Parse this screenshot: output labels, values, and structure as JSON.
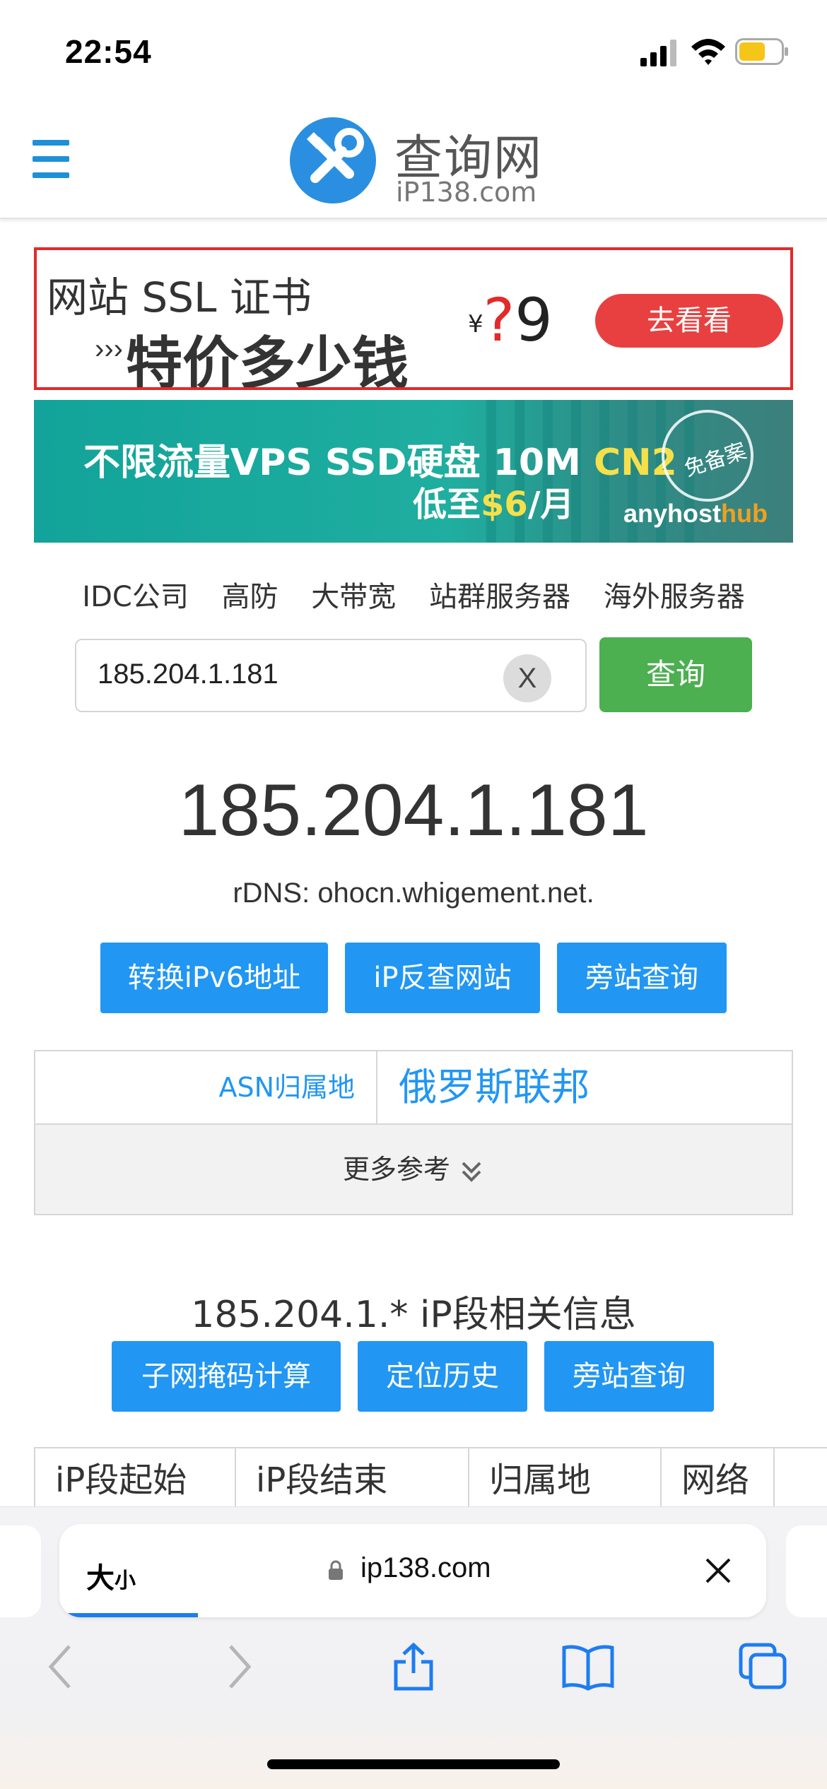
{
  "status_bar": {
    "time": "22:54"
  },
  "header": {
    "logo_title": "查询网",
    "logo_domain": "iP138.com"
  },
  "ads": {
    "ssl": {
      "line1": "网站 SSL 证书",
      "line2": "特价多少钱",
      "currency": "¥",
      "question": "?",
      "price": "9",
      "button": "去看看"
    },
    "vps": {
      "line1_pre": "不限流量VPS SSD硬盘 10M ",
      "line1_hl": "CN2",
      "line2_pre": "低至",
      "line2_hl": "$6",
      "line2_post": "/月",
      "badge": "免备案",
      "brand_pre": "anyhost",
      "brand_hl": "hub"
    }
  },
  "nav_links": [
    "IDC公司",
    "高防",
    "大带宽",
    "站群服务器",
    "海外服务器"
  ],
  "search": {
    "value": "185.204.1.181",
    "clear_label": "X",
    "submit_label": "查询"
  },
  "result": {
    "ip": "185.204.1.181",
    "rdns": "rDNS: ohocn.whigement.net.",
    "actions": [
      "转换iPv6地址",
      "iP反查网站",
      "旁站查询"
    ]
  },
  "asn": {
    "label": "ASN归属地",
    "value": "俄罗斯联邦",
    "more": "更多参考"
  },
  "segment": {
    "title": "185.204.1.* iP段相关信息",
    "actions": [
      "子网掩码计算",
      "定位历史",
      "旁站查询"
    ],
    "columns": [
      "iP段起始",
      "iP段结束",
      "归属地",
      "网络"
    ]
  },
  "browser": {
    "text_size": "大",
    "text_size_small": "小",
    "url": "ip138.com"
  },
  "colors": {
    "accent_blue": "#2196f3",
    "search_green": "#4caf50",
    "ad_red": "#e12a2a"
  }
}
